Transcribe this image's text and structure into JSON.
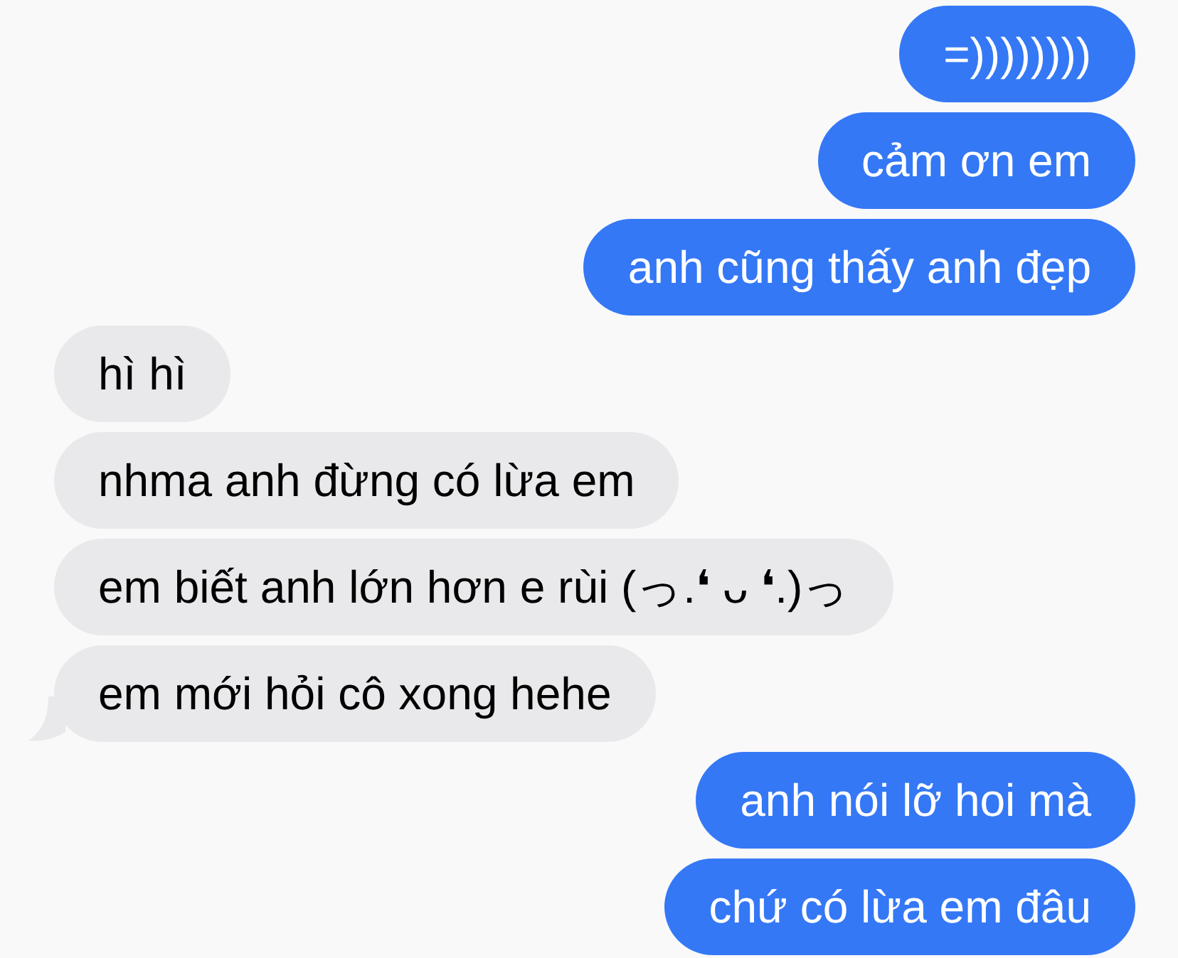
{
  "messages": [
    {
      "kind": "sent",
      "text": "=))))))))",
      "tail": false
    },
    {
      "kind": "sent",
      "text": "cảm ơn em",
      "tail": false
    },
    {
      "kind": "sent",
      "text": "anh cũng thấy anh đẹp",
      "tail": false
    },
    {
      "kind": "received",
      "text": "hì hì",
      "tail": false
    },
    {
      "kind": "received",
      "text": "nhma anh đừng có lừa em",
      "tail": false
    },
    {
      "kind": "received",
      "text": "em biết anh lớn hơn e rùi (っ.❛ ᴗ ❛.)っ",
      "tail": false
    },
    {
      "kind": "received",
      "text": "em mới hỏi cô xong hehe",
      "tail": true
    },
    {
      "kind": "sent",
      "text": "anh nói lỡ hoi mà",
      "tail": false
    },
    {
      "kind": "sent",
      "text": "chứ có lừa em đâu",
      "tail": false
    }
  ]
}
